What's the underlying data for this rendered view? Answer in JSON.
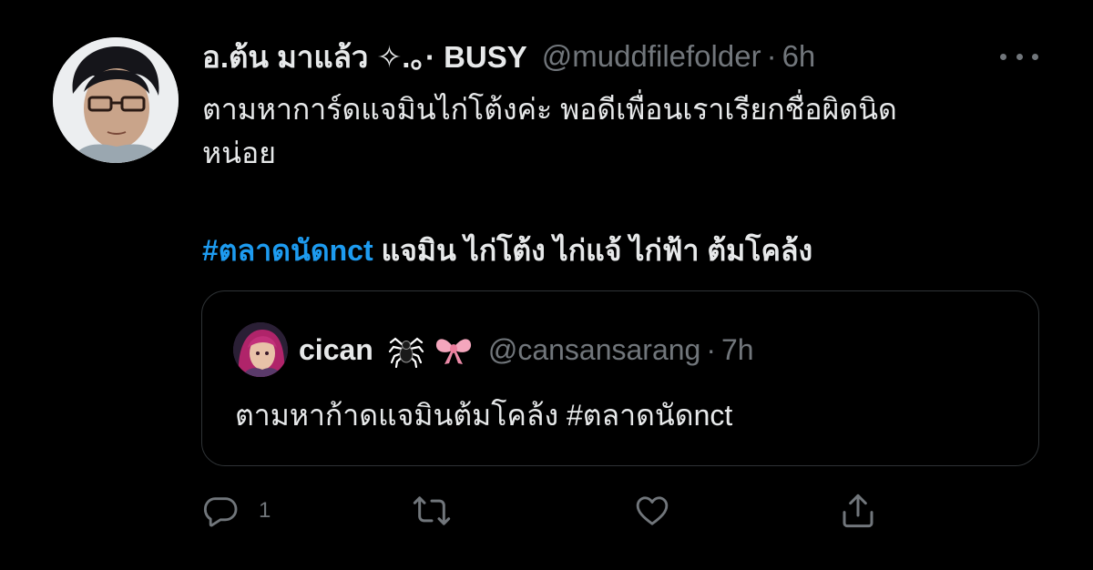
{
  "tweet": {
    "display_name": "อ.ต้น มาแล้ว ✧.。· BUSY",
    "handle": "@muddfilefolder",
    "separator": "·",
    "time": "6h",
    "body_line1": "ตามหาการ์ดแจมินไก่โต้งค่ะ พอดีเพื่อนเราเรียกชื่อผิดนิด",
    "body_line2": "หน่อย",
    "hashtag": "#ตลาดนัดnct",
    "tags_rest": " แจมิน ไก่โต้ง ไก่แจ้ ไก่ฟ้า ต้มโคล้ง"
  },
  "quote": {
    "display_name": "cican",
    "emoji_1": "spider-emoji",
    "emoji_2": "bow-emoji",
    "handle": "@cansansarang",
    "separator": "·",
    "time": "7h",
    "text": "ตามหาก้าดแจมินต้มโคล้ง #ตลาดนัดnct"
  },
  "actions": {
    "reply_count": "1",
    "reply_icon": "reply-icon",
    "retweet_icon": "retweet-icon",
    "like_icon": "heart-icon",
    "share_icon": "share-icon"
  },
  "colors": {
    "background": "#000000",
    "text": "#e7e9ea",
    "secondary": "#71767b",
    "link": "#1d9bf0",
    "border": "#2f3336"
  }
}
